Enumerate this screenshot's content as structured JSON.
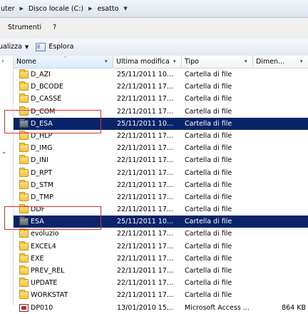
{
  "address": {
    "segments": [
      "uter",
      "Disco locale (C:)",
      "esatto"
    ]
  },
  "menu": {
    "items": [
      "Strumenti",
      "?"
    ]
  },
  "toolbar": {
    "left_label": "ualizza",
    "explore_label": "Esplora"
  },
  "columns": {
    "name": "Nome",
    "date": "Ultima modifica",
    "type": "Tipo",
    "size": "Dimen..."
  },
  "rows": [
    {
      "name": "D_AZI",
      "date": "25/11/2011 10...",
      "type": "Cartella di file",
      "size": "",
      "icon": "folder-icon",
      "selected": false
    },
    {
      "name": "D_BCODE",
      "date": "22/11/2011 17...",
      "type": "Cartella di file",
      "size": "",
      "icon": "folder-icon",
      "selected": false
    },
    {
      "name": "D_CASSE",
      "date": "22/11/2011 17...",
      "type": "Cartella di file",
      "size": "",
      "icon": "folder-icon",
      "selected": false
    },
    {
      "name": "D_COM",
      "date": "22/11/2011 17...",
      "type": "Cartella di file",
      "size": "",
      "icon": "folder-icon",
      "selected": false
    },
    {
      "name": "D_ESA",
      "date": "25/11/2011 10...",
      "type": "Cartella di file",
      "size": "",
      "icon": "locked-folder-icon",
      "selected": true
    },
    {
      "name": "D_HLP",
      "date": "22/11/2011 17...",
      "type": "Cartella di file",
      "size": "",
      "icon": "folder-icon",
      "selected": false
    },
    {
      "name": "D_IMG",
      "date": "22/11/2011 17...",
      "type": "Cartella di file",
      "size": "",
      "icon": "folder-icon",
      "selected": false
    },
    {
      "name": "D_INI",
      "date": "22/11/2011 17...",
      "type": "Cartella di file",
      "size": "",
      "icon": "folder-icon",
      "selected": false
    },
    {
      "name": "D_RPT",
      "date": "22/11/2011 17...",
      "type": "Cartella di file",
      "size": "",
      "icon": "folder-icon",
      "selected": false
    },
    {
      "name": "D_STM",
      "date": "22/11/2011 17...",
      "type": "Cartella di file",
      "size": "",
      "icon": "folder-icon",
      "selected": false
    },
    {
      "name": "D_TMP",
      "date": "22/11/2011 17...",
      "type": "Cartella di file",
      "size": "",
      "icon": "folder-icon",
      "selected": false
    },
    {
      "name": "DDF",
      "date": "22/11/2011 17...",
      "type": "Cartella di file",
      "size": "",
      "icon": "folder-icon",
      "selected": false
    },
    {
      "name": "ESA",
      "date": "25/11/2011 10...",
      "type": "Cartella di file",
      "size": "",
      "icon": "locked-folder-icon",
      "selected": true
    },
    {
      "name": "evoluzio",
      "date": "22/11/2011 17...",
      "type": "Cartella di file",
      "size": "",
      "icon": "folder-icon",
      "selected": false
    },
    {
      "name": "EXCEL4",
      "date": "22/11/2011 17...",
      "type": "Cartella di file",
      "size": "",
      "icon": "folder-icon",
      "selected": false
    },
    {
      "name": "EXE",
      "date": "22/11/2011 17...",
      "type": "Cartella di file",
      "size": "",
      "icon": "folder-icon",
      "selected": false
    },
    {
      "name": "PREV_REL",
      "date": "22/11/2011 17...",
      "type": "Cartella di file",
      "size": "",
      "icon": "folder-icon",
      "selected": false
    },
    {
      "name": "UPDATE",
      "date": "22/11/2011 17...",
      "type": "Cartella di file",
      "size": "",
      "icon": "folder-icon",
      "selected": false
    },
    {
      "name": "WORKSTAT",
      "date": "22/11/2011 17...",
      "type": "Cartella di file",
      "size": "",
      "icon": "folder-icon",
      "selected": false
    },
    {
      "name": "DP010",
      "date": "13/01/2010 15...",
      "type": "Microsoft Access ...",
      "size": "864 KB",
      "icon": "access-file-icon",
      "selected": false
    }
  ],
  "colors": {
    "selection": "#0a246a",
    "highlight_box": "#e03030"
  }
}
